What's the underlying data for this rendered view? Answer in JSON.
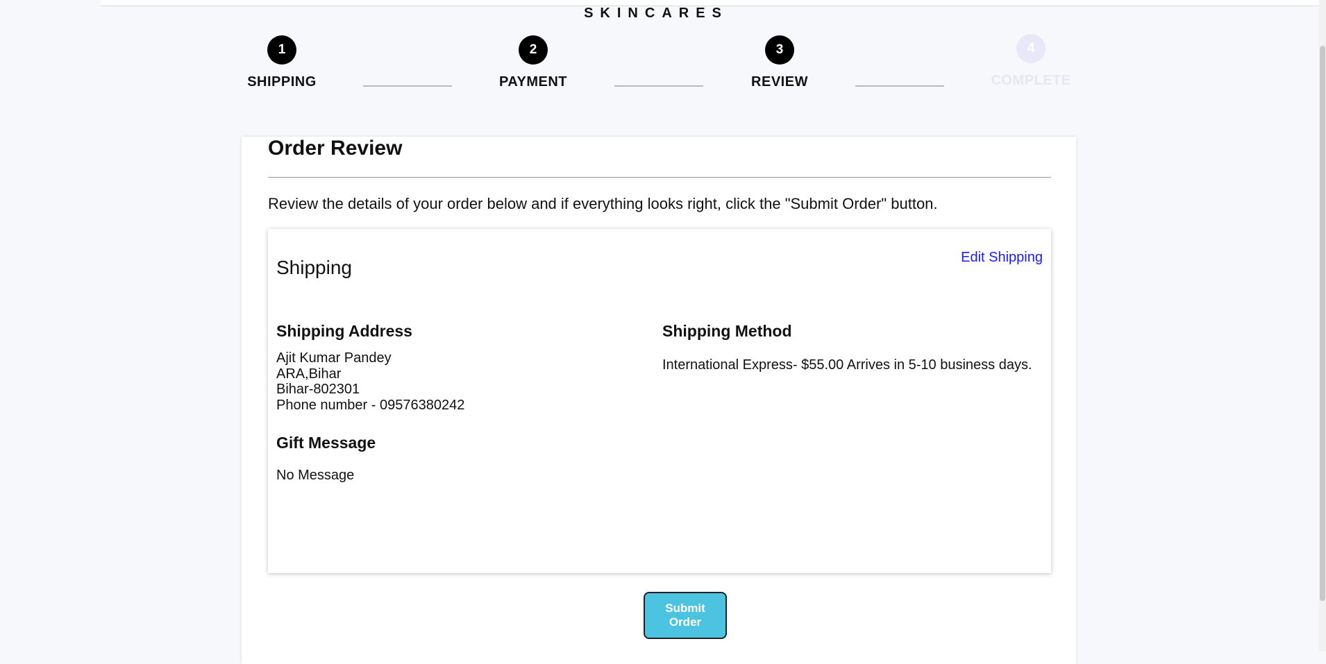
{
  "brand": "SKINCARES",
  "steps": [
    {
      "num": "1",
      "label": "SHIPPING"
    },
    {
      "num": "2",
      "label": "PAYMENT"
    },
    {
      "num": "3",
      "label": "REVIEW"
    },
    {
      "num": "4",
      "label": "COMPLETE"
    }
  ],
  "review": {
    "title": "Order Review",
    "intro": "Review the details of your order below and if everything looks right, click the \"Submit Order\" button.",
    "shipping": {
      "heading": "Shipping",
      "edit_link": "Edit Shipping",
      "address_heading": "Shipping Address",
      "address_lines": [
        "Ajit Kumar Pandey",
        "ARA,Bihar",
        "Bihar-802301",
        "Phone number - 09576380242"
      ],
      "method_heading": "Shipping Method",
      "method": "International Express- $55.00 Arrives in 5-10 business days.",
      "gift_heading": "Gift Message",
      "gift_message": "No Message"
    },
    "submit_label": "Submit Order"
  },
  "colors": {
    "step_active": "#000000",
    "step_inactive": "#e8e8f8",
    "link": "#1a1aff",
    "submit_bg": "#4cc3e0",
    "page_bg": "#f7f8fc"
  }
}
